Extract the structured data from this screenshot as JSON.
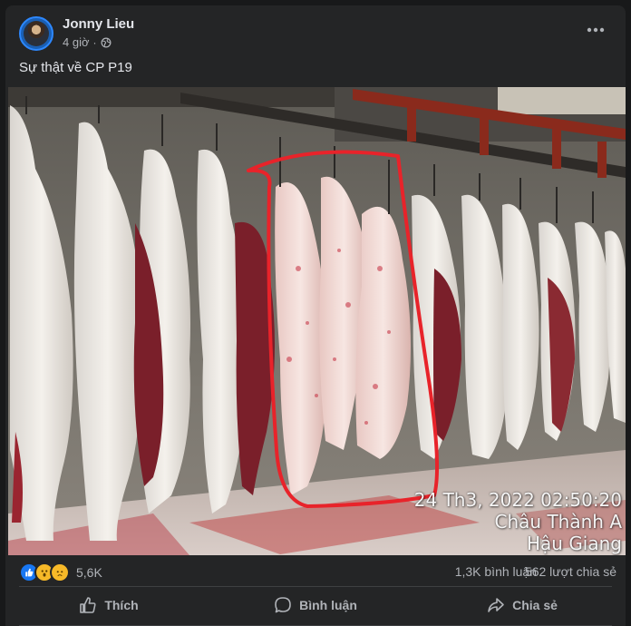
{
  "post": {
    "author": "Jonny Lieu",
    "time": "4 giờ",
    "separator": "·",
    "audience_icon": "globe-icon",
    "more_icon": "more-options-icon",
    "caption": "Sự thật về CP P19"
  },
  "photo": {
    "description_icon": "photo",
    "timestamp_line1": "24 Th3, 2022 02:50:20",
    "timestamp_line2": "Châu Thành A",
    "timestamp_line3": "Hậu Giang",
    "highlight_color": "#e8232a"
  },
  "stats": {
    "reactions": [
      "like",
      "wow",
      "sad"
    ],
    "reaction_count": "5,6K",
    "comments": "1,3K bình luận",
    "shares": "562 lượt chia sẻ"
  },
  "actions": {
    "like_label": "Thích",
    "comment_label": "Bình luận",
    "share_label": "Chia sẻ"
  },
  "colors": {
    "background": "#18191a",
    "card": "#242526",
    "text_primary": "#e4e6eb",
    "text_secondary": "#b0b3b8",
    "like_blue": "#1877f2"
  }
}
